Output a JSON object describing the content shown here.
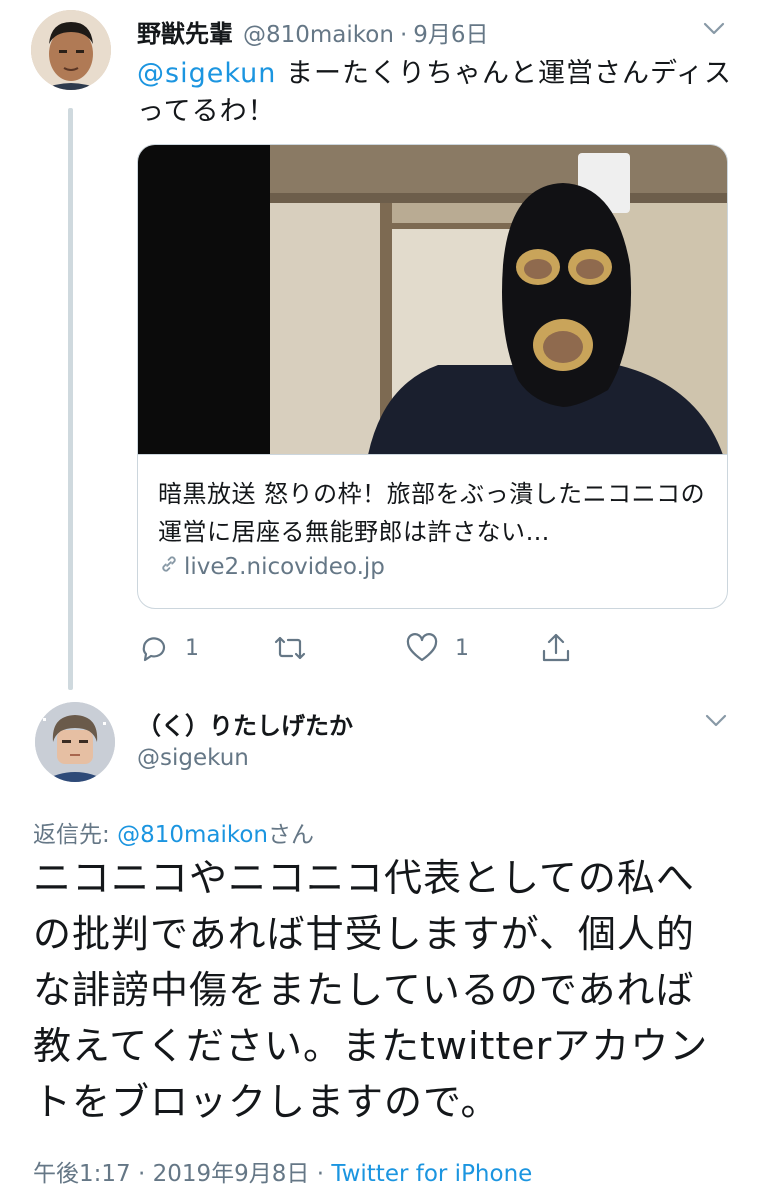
{
  "tweet1": {
    "display_name": "野獣先輩",
    "handle": "@810maikon",
    "separator": "·",
    "date": "9月6日",
    "mention": "@sigekun",
    "text": " まーたくりちゃんと運営さんディスってるわ！",
    "card": {
      "title": "暗黒放送 怒りの枠！旅部をぶっ潰したニコニコの運営に居座る無能野郎は許さない…",
      "domain": "live2.nicovideo.jp"
    },
    "actions": {
      "reply_count": "1",
      "retweet_count": "",
      "like_count": "1"
    }
  },
  "tweet2": {
    "display_name": "（く）りたしげたか",
    "handle": "@sigekun",
    "reply_prefix": "返信先: ",
    "reply_mention": "@810maikon",
    "reply_suffix": "さん",
    "text": "ニコニコやニコニコ代表としての私への批判であれば甘受しますが、個人的な誹謗中傷をまたしているのであれば教えてください。またtwitterアカウントをブロックしますので。",
    "time": "午後1:17",
    "separator": " · ",
    "date": "2019年9月8日",
    "separator2": " · ",
    "source": "Twitter for iPhone"
  },
  "colors": {
    "link": "#1b95e0",
    "secondary_text": "#657786",
    "primary_text": "#14171a",
    "border": "#ccd6dd",
    "thread_line": "#cfd9de"
  },
  "icons": [
    "chevron-down-icon",
    "link-icon",
    "reply-icon",
    "retweet-icon",
    "like-icon",
    "share-icon"
  ]
}
